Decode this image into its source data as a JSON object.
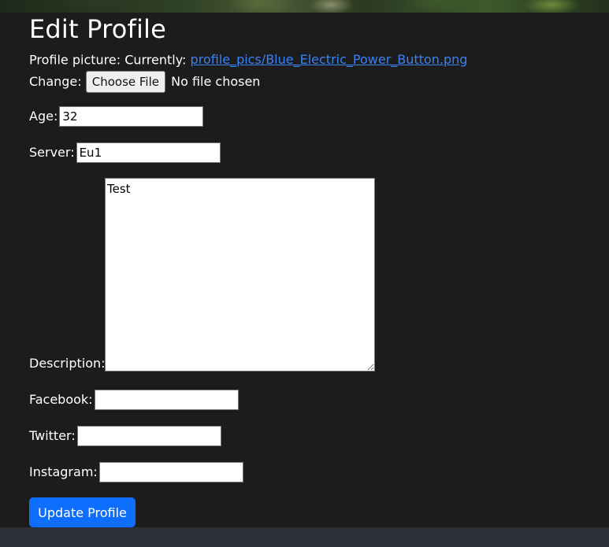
{
  "page": {
    "title": "Edit Profile"
  },
  "profile_picture": {
    "label": "Profile picture: Currently:",
    "current_file": "profile_pics/Blue_Electric_Power_Button.png",
    "change_label": "Change:",
    "choose_button": "Choose File",
    "no_file_text": "No file chosen"
  },
  "fields": {
    "age": {
      "label": "Age:",
      "value": "32"
    },
    "server": {
      "label": "Server:",
      "value": "Eu1"
    },
    "description": {
      "label": "Description:",
      "value": "Test"
    },
    "facebook": {
      "label": "Facebook:",
      "value": ""
    },
    "twitter": {
      "label": "Twitter:",
      "value": ""
    },
    "instagram": {
      "label": "Instagram:",
      "value": ""
    }
  },
  "actions": {
    "submit_label": "Update Profile"
  },
  "colors": {
    "background": "#1c1c1c",
    "accent": "#0d6efd",
    "link": "#3b82f6",
    "footer": "#2b2f36"
  }
}
